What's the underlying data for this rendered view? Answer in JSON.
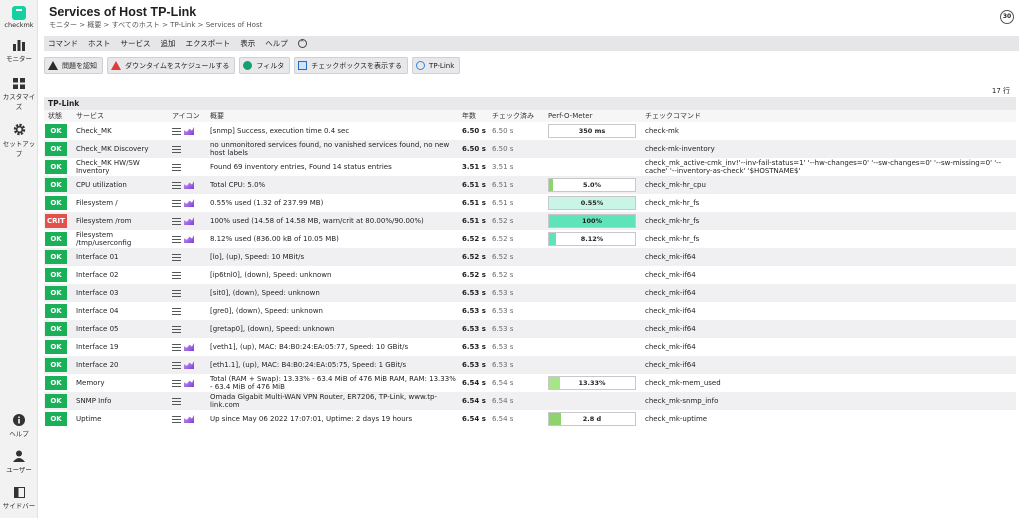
{
  "sidebar": {
    "logo_label": "checkmk",
    "items": [
      {
        "label": "モニター",
        "icon": "bar-chart-icon"
      },
      {
        "label": "カスタマイズ",
        "icon": "grid-icon"
      },
      {
        "label": "セットアップ",
        "icon": "gear-icon"
      }
    ],
    "bottom": [
      {
        "label": "ヘルプ",
        "icon": "info-icon"
      },
      {
        "label": "ユーザー",
        "icon": "user-icon"
      },
      {
        "label": "サイドバー",
        "icon": "sidebar-icon"
      }
    ]
  },
  "header": {
    "title": "Services of Host TP-Link",
    "breadcrumb": "モニター > 概要 > すべてのホスト > TP-Link > Services of Host",
    "refresh": "30"
  },
  "menubar": [
    "コマンド",
    "ホスト",
    "サービス",
    "追加",
    "エクスポート",
    "表示",
    "ヘルプ"
  ],
  "toolbar": [
    "問題を認知",
    "ダウンタイムをスケジュールする",
    "フィルタ",
    "チェックボックスを表示する",
    "TP-Link"
  ],
  "row_count": "17 行",
  "table": {
    "group": "TP-Link",
    "headers": [
      "状態",
      "サービス",
      "アイコン",
      "概要",
      "年数",
      "チェック済み",
      "Perf-O-Meter",
      "チェックコマンド"
    ],
    "rows": [
      {
        "state": "OK",
        "service": "Check_MK",
        "graph": true,
        "summary": "[snmp] Success, execution time 0.4 sec",
        "age": "6.50 s",
        "checked": "6.50 s",
        "perf": "350 ms",
        "perf_pct": 0,
        "perf_color": "#8ed36b",
        "cmd": "check-mk"
      },
      {
        "state": "OK",
        "service": "Check_MK Discovery",
        "graph": false,
        "summary": "no unmonitored services found, no vanished services found, no new host labels",
        "age": "6.50 s",
        "checked": "6.50 s",
        "perf": "",
        "cmd": "check-mk-inventory"
      },
      {
        "state": "OK",
        "service": "Check_MK HW/SW Inventory",
        "graph": false,
        "summary": "Found 69 inventory entries, Found 14 status entries",
        "age": "3.51 s",
        "checked": "3.51 s",
        "perf": "",
        "cmd": "check_mk_active-cmk_inv!'--inv-fail-status=1' '--hw-changes=0' '--sw-changes=0' '--sw-missing=0' '--cache' '--inventory-as-check' '$HOSTNAME$'"
      },
      {
        "state": "OK",
        "service": "CPU utilization",
        "graph": true,
        "summary": "Total CPU: 5.0%",
        "age": "6.51 s",
        "checked": "6.51 s",
        "perf": "5.0%",
        "perf_pct": 5,
        "perf_color": "#8ed36b",
        "cmd": "check_mk-hr_cpu"
      },
      {
        "state": "OK",
        "service": "Filesystem /",
        "graph": true,
        "summary": "0.55% used (1.32 of 237.99 MB)",
        "age": "6.51 s",
        "checked": "6.51 s",
        "perf": "0.55%",
        "perf_pct": 100,
        "perf_color": "#c9f5e6",
        "cmd": "check_mk-hr_fs"
      },
      {
        "state": "CRIT",
        "service": "Filesystem /rom",
        "graph": true,
        "summary": "100% used (14.58 of 14.58 MB, warn/crit at 80.00%/90.00%)",
        "age": "6.51 s",
        "checked": "6.52 s",
        "perf": "100%",
        "perf_pct": 100,
        "perf_color": "#5fe3b8",
        "cmd": "check_mk-hr_fs"
      },
      {
        "state": "OK",
        "service": "Filesystem /tmp/userconfig",
        "graph": true,
        "summary": "8.12% used (836.00 kB of 10.05 MB)",
        "age": "6.52 s",
        "checked": "6.52 s",
        "perf": "8.12%",
        "perf_pct": 8.12,
        "perf_color": "#5fe3b8",
        "cmd": "check_mk-hr_fs"
      },
      {
        "state": "OK",
        "service": "Interface 01",
        "graph": false,
        "summary": "[lo], (up), Speed: 10 MBit/s",
        "age": "6.52 s",
        "checked": "6.52 s",
        "perf": "",
        "cmd": "check_mk-if64"
      },
      {
        "state": "OK",
        "service": "Interface 02",
        "graph": false,
        "summary": "[ip6tnl0], (down), Speed: unknown",
        "age": "6.52 s",
        "checked": "6.52 s",
        "perf": "",
        "cmd": "check_mk-if64"
      },
      {
        "state": "OK",
        "service": "Interface 03",
        "graph": false,
        "summary": "[sit0], (down), Speed: unknown",
        "age": "6.53 s",
        "checked": "6.53 s",
        "perf": "",
        "cmd": "check_mk-if64"
      },
      {
        "state": "OK",
        "service": "Interface 04",
        "graph": false,
        "summary": "[gre0], (down), Speed: unknown",
        "age": "6.53 s",
        "checked": "6.53 s",
        "perf": "",
        "cmd": "check_mk-if64"
      },
      {
        "state": "OK",
        "service": "Interface 05",
        "graph": false,
        "summary": "[gretap0], (down), Speed: unknown",
        "age": "6.53 s",
        "checked": "6.53 s",
        "perf": "",
        "cmd": "check_mk-if64"
      },
      {
        "state": "OK",
        "service": "Interface 19",
        "graph": true,
        "summary": "[veth1], (up), MAC: B4:B0:24:EA:05:77, Speed: 10 GBit/s",
        "age": "6.53 s",
        "checked": "6.53 s",
        "perf": "",
        "cmd": "check_mk-if64"
      },
      {
        "state": "OK",
        "service": "Interface 20",
        "graph": true,
        "summary": "[eth1.1], (up), MAC: B4:B0:24:EA:05:75, Speed: 1 GBit/s",
        "age": "6.53 s",
        "checked": "6.53 s",
        "perf": "",
        "cmd": "check_mk-if64"
      },
      {
        "state": "OK",
        "service": "Memory",
        "graph": true,
        "summary": "Total (RAM + Swap): 13.33% - 63.4 MiB of 476 MiB RAM, RAM: 13.33% - 63.4 MiB of 476 MiB",
        "age": "6.54 s",
        "checked": "6.54 s",
        "perf": "13.33%",
        "perf_pct": 13.33,
        "perf_color": "#a8e58a",
        "cmd": "check_mk-mem_used"
      },
      {
        "state": "OK",
        "service": "SNMP Info",
        "graph": false,
        "summary": "Omada Gigabit Multi-WAN VPN Router, ER7206, TP-Link, www.tp-link.com",
        "age": "6.54 s",
        "checked": "6.54 s",
        "perf": "",
        "cmd": "check_mk-snmp_info"
      },
      {
        "state": "OK",
        "service": "Uptime",
        "graph": true,
        "summary": "Up since May 06 2022 17:07:01, Uptime: 2 days 19 hours",
        "age": "6.54 s",
        "checked": "6.54 s",
        "perf": "2.8 d",
        "perf_pct": 14,
        "perf_color": "#8ed36b",
        "cmd": "check_mk-uptime"
      }
    ]
  }
}
